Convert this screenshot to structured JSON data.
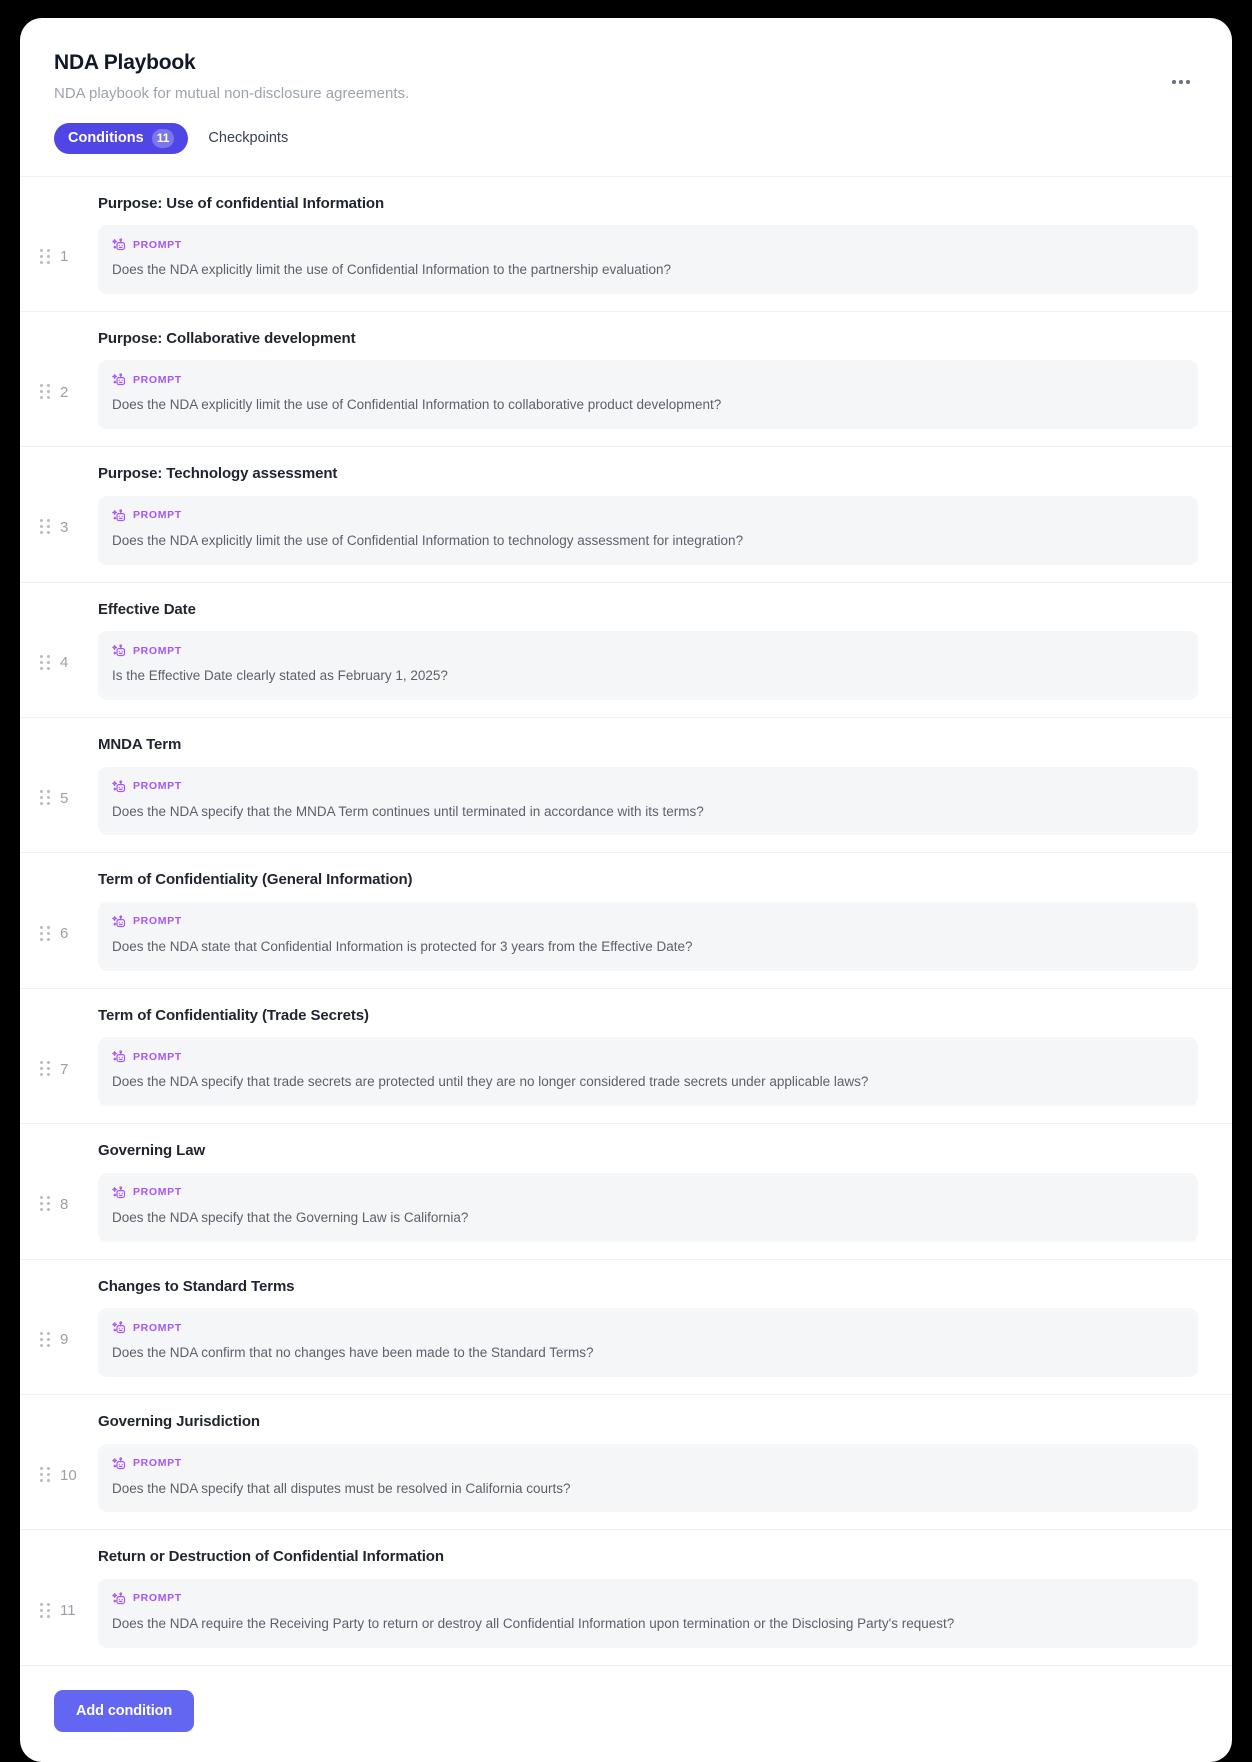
{
  "header": {
    "title": "NDA Playbook",
    "subtitle": "NDA playbook for mutual non-disclosure agreements.",
    "kebab_icon": "more-horizontal-icon"
  },
  "tabs": [
    {
      "label": "Conditions",
      "badge": "11",
      "active": true
    },
    {
      "label": "Checkpoints",
      "badge": "",
      "active": false
    }
  ],
  "prompt_tag_label": "PROMPT",
  "prompt_icon": "ai-sparkle-prompt-icon",
  "drag_handle_icon": "drag-handle-icon",
  "conditions": [
    {
      "index": "1",
      "title": "Purpose: Use of confidential Information",
      "prompt": "Does the NDA explicitly limit the use of Confidential Information to the partnership evaluation?"
    },
    {
      "index": "2",
      "title": "Purpose: Collaborative development",
      "prompt": "Does the NDA explicitly limit the use of Confidential Information to collaborative product development?"
    },
    {
      "index": "3",
      "title": "Purpose: Technology assessment",
      "prompt": "Does the NDA explicitly limit the use of Confidential Information to technology assessment for integration?"
    },
    {
      "index": "4",
      "title": "Effective Date",
      "prompt": "Is the Effective Date clearly stated as February 1, 2025?"
    },
    {
      "index": "5",
      "title": "MNDA Term",
      "prompt": "Does the NDA specify that the MNDA Term continues until terminated in accordance with its terms?"
    },
    {
      "index": "6",
      "title": "Term of Confidentiality (General Information)",
      "prompt": "Does the NDA state that Confidential Information is protected for 3 years from the Effective Date?"
    },
    {
      "index": "7",
      "title": "Term of Confidentiality (Trade Secrets)",
      "prompt": "Does the NDA specify that trade secrets are protected until they are no longer considered trade secrets under applicable laws?"
    },
    {
      "index": "8",
      "title": "Governing Law",
      "prompt": "Does the NDA specify that the Governing Law is California?"
    },
    {
      "index": "9",
      "title": "Changes to Standard Terms",
      "prompt": "Does the NDA confirm that no changes have been made to the Standard Terms?"
    },
    {
      "index": "10",
      "title": "Governing Jurisdiction",
      "prompt": "Does the NDA specify that all disputes must be resolved in California courts?"
    },
    {
      "index": "11",
      "title": "Return or Destruction of Confidential Information",
      "prompt": "Does the NDA require the Receiving Party to return or destroy all Confidential Information upon termination or the Disclosing Party's request?"
    }
  ],
  "footer": {
    "add_condition_label": "Add condition"
  },
  "colors": {
    "accent": "#4f46e5",
    "button": "#6366f1",
    "badge": "#7b76ec",
    "prompt_purple": "#a855f7",
    "prompt_bg": "#f5f6f8",
    "title_text": "#1f2430",
    "muted_text": "#9ca3af"
  }
}
